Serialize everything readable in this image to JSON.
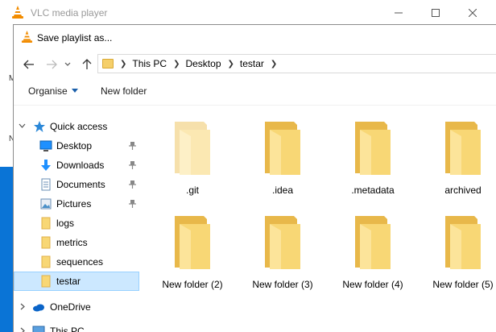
{
  "vlc": {
    "title": "VLC media player",
    "left_menu_1": "M",
    "left_menu_2": "N"
  },
  "dialog": {
    "title": "Save playlist as..."
  },
  "address": {
    "crumbs": [
      "This PC",
      "Desktop",
      "testar"
    ]
  },
  "toolbar": {
    "organise_label": "Organise",
    "new_folder_label": "New folder"
  },
  "sidebar": {
    "quick_access": "Quick access",
    "items": [
      {
        "label": "Desktop",
        "icon": "desktop-icon",
        "pinned": true
      },
      {
        "label": "Downloads",
        "icon": "download-icon",
        "pinned": true
      },
      {
        "label": "Documents",
        "icon": "documents-icon",
        "pinned": true
      },
      {
        "label": "Pictures",
        "icon": "pictures-icon",
        "pinned": true
      },
      {
        "label": "logs",
        "icon": "folder-icon",
        "pinned": false
      },
      {
        "label": "metrics",
        "icon": "folder-icon",
        "pinned": false
      },
      {
        "label": "sequences",
        "icon": "folder-icon",
        "pinned": false
      },
      {
        "label": "testar",
        "icon": "folder-icon",
        "pinned": false,
        "selected": true
      }
    ],
    "onedrive": "OneDrive",
    "this_pc": "This PC"
  },
  "files": [
    {
      "name": ".git",
      "hidden": true
    },
    {
      "name": ".idea",
      "hidden": false
    },
    {
      "name": ".metadata",
      "hidden": false
    },
    {
      "name": "archived",
      "hidden": false
    },
    {
      "name": "New folder (2)",
      "hidden": false
    },
    {
      "name": "New folder (3)",
      "hidden": false
    },
    {
      "name": "New folder (4)",
      "hidden": false
    },
    {
      "name": "New folder (5)",
      "hidden": false
    }
  ],
  "colors": {
    "folder": "#f8d775",
    "folder_dark": "#e8b84a",
    "selection_bg": "#cce8ff",
    "accent": "#0a74d6"
  }
}
